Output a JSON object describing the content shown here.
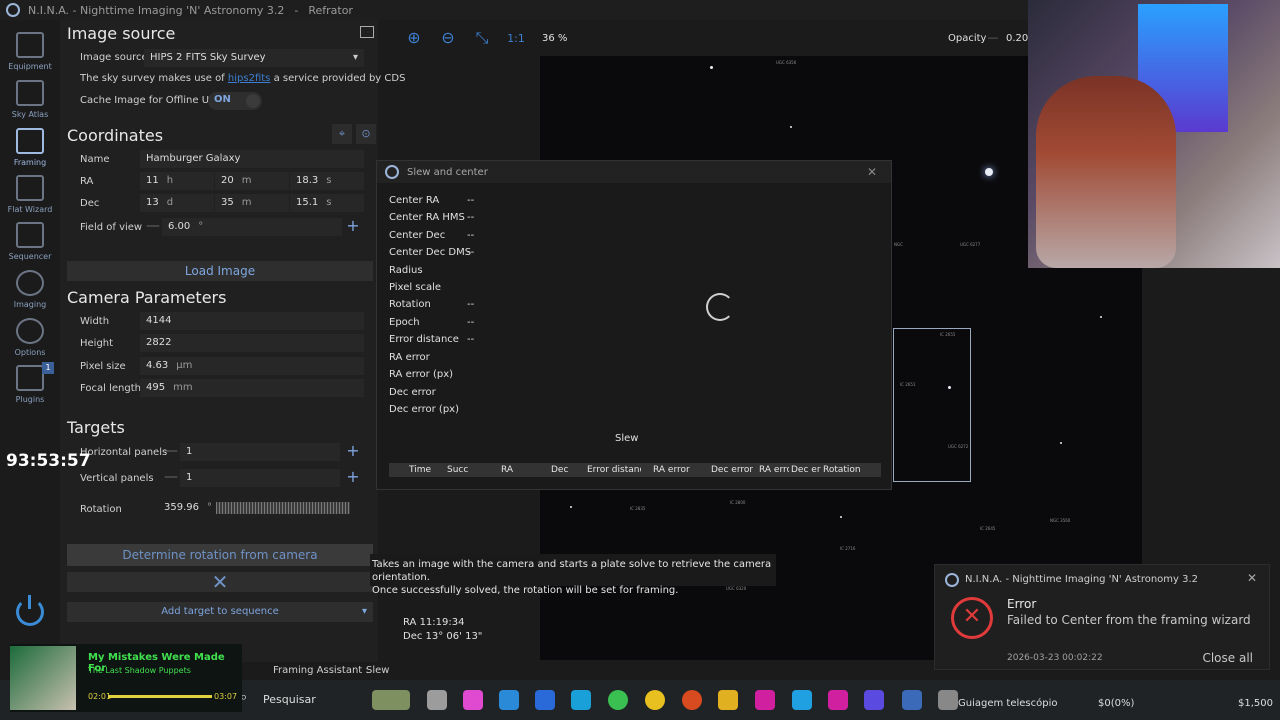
{
  "window": {
    "title": "N.I.N.A. - Nighttime Imaging 'N' Astronomy 3.2",
    "profile": "Refrator"
  },
  "nav": [
    {
      "label": "Equipment"
    },
    {
      "label": "Sky Atlas"
    },
    {
      "label": "Framing"
    },
    {
      "label": "Flat Wizard"
    },
    {
      "label": "Sequencer"
    },
    {
      "label": "Imaging"
    },
    {
      "label": "Options"
    },
    {
      "label": "Plugins"
    }
  ],
  "plugins_badge": "1",
  "image_source": {
    "heading": "Image source",
    "label": "Image source",
    "value": "HIPS 2 FITS Sky Survey",
    "note_pre": "The sky survey makes use of",
    "note_link": "hips2fits",
    "note_post": "a service provided by CDS",
    "cache_label": "Cache Image for Offline Use",
    "cache_state": "ON"
  },
  "coordinates": {
    "heading": "Coordinates",
    "name_label": "Name",
    "name_value": "Hamburger Galaxy",
    "ra_label": "RA",
    "ra_h": "11",
    "ra_h_unit": "h",
    "ra_m": "20",
    "ra_m_unit": "m",
    "ra_s": "18.3",
    "ra_s_unit": "s",
    "dec_label": "Dec",
    "dec_d": "13",
    "dec_d_unit": "d",
    "dec_m": "35",
    "dec_m_unit": "m",
    "dec_s": "15.1",
    "dec_s_unit": "s",
    "fov_label": "Field of view",
    "fov_value": "6.00",
    "fov_unit": "°"
  },
  "load_image": "Load Image",
  "camera": {
    "heading": "Camera Parameters",
    "width_label": "Width",
    "width_value": "4144",
    "height_label": "Height",
    "height_value": "2822",
    "pixel_label": "Pixel size",
    "pixel_value": "4.63",
    "pixel_unit": "µm",
    "focal_label": "Focal length",
    "focal_value": "495",
    "focal_unit": "mm"
  },
  "targets": {
    "heading": "Targets",
    "hpanels_label": "Horizontal panels",
    "hpanels_value": "1",
    "vpanels_label": "Vertical panels",
    "vpanels_value": "1",
    "rotation_label": "Rotation",
    "rotation_value": "359.96",
    "rotation_unit": "°"
  },
  "determine_rotation": "Determine rotation from camera",
  "add_target": "Add target to sequence",
  "tooltip": {
    "line1": "Takes an image with the camera and starts a plate solve to retrieve the camera orientation.",
    "line2": "Once successfully solved, the rotation will be set for framing."
  },
  "toolbar": {
    "zoom": "36 %",
    "one_to_one": "1:1",
    "opacity_label": "Opacity",
    "opacity_value": "0.20"
  },
  "radec_overlay": {
    "ra": "RA  11:19:34",
    "dec": "Dec  13° 06' 13\""
  },
  "dialog": {
    "title": "Slew and center",
    "rows": [
      {
        "label": "Center RA",
        "value": "--"
      },
      {
        "label": "Center RA HMS",
        "value": "--"
      },
      {
        "label": "Center Dec",
        "value": "--"
      },
      {
        "label": "Center Dec DMS",
        "value": "--"
      },
      {
        "label": "Radius",
        "value": ""
      },
      {
        "label": "Pixel scale",
        "value": ""
      },
      {
        "label": "Rotation",
        "value": "--"
      },
      {
        "label": "Epoch",
        "value": "--"
      },
      {
        "label": "Error distance",
        "value": "--"
      },
      {
        "label": "RA error",
        "value": ""
      },
      {
        "label": "RA error (px)",
        "value": ""
      },
      {
        "label": "Dec error",
        "value": ""
      },
      {
        "label": "Dec error (px)",
        "value": ""
      }
    ],
    "slew_button": "Slew",
    "columns": [
      "Time",
      "Succ",
      "RA",
      "Dec",
      "Error distance",
      "RA error",
      "Dec error",
      "RA erro",
      "Dec erro",
      "Rotation"
    ]
  },
  "toast": {
    "app": "N.I.N.A. - Nighttime Imaging 'N' Astronomy 3.2",
    "heading": "Error",
    "message": "Failed to Center from the framing wizard",
    "date": "2026-03-23 00:02:22",
    "close_all": "Close all"
  },
  "statusbar": {
    "left": "Framing Assistant :",
    "right": "Slew"
  },
  "timer": "93:53:57",
  "music": {
    "title": "My Mistakes Were Made For",
    "artist": "The Last Shadow Puppets",
    "elapsed": "02:01",
    "total": "03:07"
  },
  "taskbar": {
    "search": "Pesquisar",
    "guiding": "Guiagem telescópio",
    "stat1": "$0(0%)",
    "stat2": "$1,500"
  },
  "colors": {
    "accent": "#3c7fd0",
    "error": "#e03a3a",
    "music": "#41e04e"
  }
}
